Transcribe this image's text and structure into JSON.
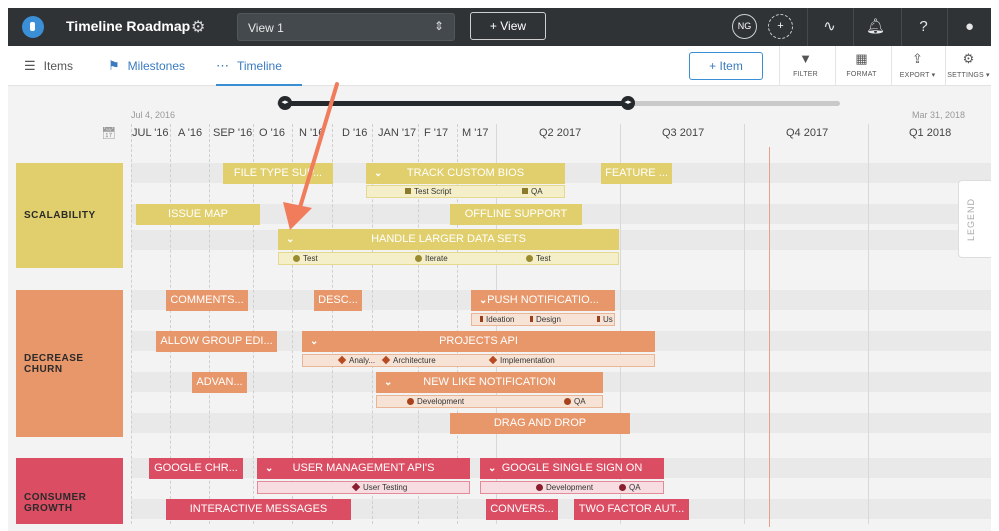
{
  "topbar": {
    "app_title": "Timeline Roadmap",
    "view_select": "View 1",
    "add_view": "+ View",
    "avatar_initials": "NG"
  },
  "nav": {
    "tabs": [
      {
        "label": "Items",
        "icon": "list-icon"
      },
      {
        "label": "Milestones",
        "icon": "flag-icon"
      },
      {
        "label": "Timeline",
        "icon": "timeline-icon"
      }
    ],
    "add_item": "+ Item",
    "tools": [
      {
        "label": "FILTER",
        "icon": "filter-icon"
      },
      {
        "label": "FORMAT",
        "icon": "format-icon"
      },
      {
        "label": "EXPORT ▾",
        "icon": "export-icon"
      },
      {
        "label": "SETTINGS ▾",
        "icon": "gear-icon"
      }
    ]
  },
  "timeline": {
    "range_start": "Jul 4, 2016",
    "range_end": "Mar 31, 2018",
    "ticks": [
      "JUL '16",
      "A '16",
      "SEP '16",
      "O '16",
      "N '16",
      "D '16",
      "JAN '17",
      "F '17",
      "M '17",
      "Q2 2017",
      "Q3 2017",
      "Q4 2017",
      "Q1 2018"
    ],
    "legend": "LEGEND"
  },
  "colors": {
    "scalability": "#e0cf6c",
    "decrease_churn": "#e8976a",
    "consumer_growth": "#db4d63",
    "accent": "#3a8ed3",
    "arrow": "#f07c5c"
  },
  "categories": [
    {
      "name": "SCALABILITY",
      "lines": [
        "SCALABILITY"
      ]
    },
    {
      "name": "DECREASE CHURN",
      "lines": [
        "DECREASE",
        "CHURN"
      ]
    },
    {
      "name": "CONSUMER GROWTH",
      "lines": [
        "CONSUMER",
        "GROWTH"
      ]
    }
  ],
  "bars": {
    "file_type": "FILE TYPE SUP...",
    "track_custom_bios": "TRACK CUSTOM BIOS",
    "feature": "FEATURE ...",
    "issue_map": "ISSUE MAP",
    "offline_support": "OFFLINE SUPPORT",
    "handle_larger": "HANDLE LARGER DATA SETS",
    "comments": "COMMENTS...",
    "desc": "DESC...",
    "push_notif": "PUSH NOTIFICATIO...",
    "allow_group": "ALLOW GROUP EDI...",
    "projects_api": "PROJECTS API",
    "advan": "ADVAN...",
    "new_like": "NEW LIKE NOTIFICATION",
    "drag_drop": "DRAG AND DROP",
    "google_chr": "GOOGLE CHR...",
    "user_mgmt": "USER MANAGEMENT API'S",
    "google_sso": "GOOGLE SINGLE SIGN ON",
    "interactive": "INTERACTIVE MESSAGES",
    "convers": "CONVERS...",
    "two_factor": "TWO FACTOR AUT..."
  },
  "milestones": {
    "test_script": "Test Script",
    "qa": "QA",
    "test": "Test",
    "iterate": "Iterate",
    "ideation": "Ideation",
    "design": "Design",
    "us": "Us",
    "analy": "Analy...",
    "architecture": "Architecture",
    "implementation": "Implementation",
    "development": "Development",
    "user_testing": "User Testing"
  }
}
